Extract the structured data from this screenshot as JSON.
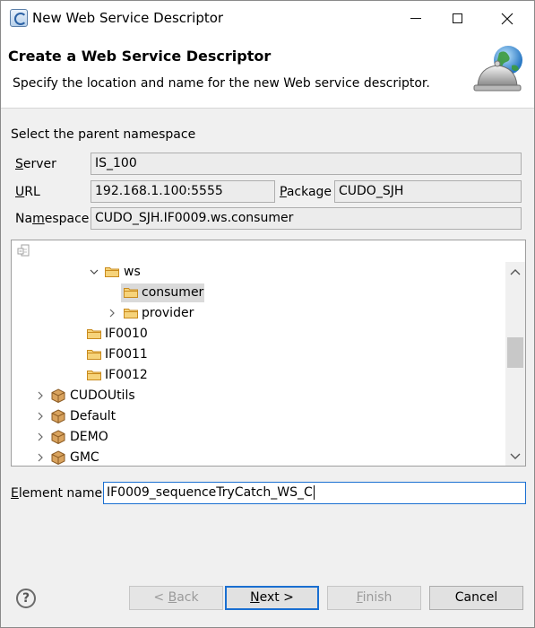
{
  "window": {
    "title": "New Web Service Descriptor"
  },
  "banner": {
    "title": "Create a Web Service Descriptor",
    "message": "Specify the location and name for the new Web service descriptor."
  },
  "form": {
    "section_label": "Select the parent namespace",
    "server": {
      "label_key": "S",
      "label_rest": "erver",
      "value": "IS_100"
    },
    "url": {
      "label_key": "U",
      "label_rest": "RL",
      "value": "192.168.1.100:5555"
    },
    "package": {
      "label_key": "P",
      "label_rest": "ackage",
      "value": "CUDO_SJH"
    },
    "namespace": {
      "label_pre": "Na",
      "label_key": "m",
      "label_rest": "espace",
      "value": "CUDO_SJH.IF0009.ws.consumer"
    }
  },
  "tree": {
    "nodes": [
      {
        "label": "ws",
        "type": "folder",
        "expanded": true
      },
      {
        "label": "consumer",
        "type": "folder",
        "selected": true
      },
      {
        "label": "provider",
        "type": "folder",
        "expanded": false
      },
      {
        "label": "IF0010",
        "type": "folder"
      },
      {
        "label": "IF0011",
        "type": "folder"
      },
      {
        "label": "IF0012",
        "type": "folder"
      },
      {
        "label": "CUDOUtils",
        "type": "package"
      },
      {
        "label": "Default",
        "type": "package"
      },
      {
        "label": "DEMO",
        "type": "package"
      },
      {
        "label": "GMC",
        "type": "package"
      }
    ]
  },
  "element": {
    "label_key": "E",
    "label_rest": "lement name",
    "value": "IF0009_sequenceTryCatch_WS_C"
  },
  "buttons": {
    "back": {
      "pre": "< ",
      "key": "B",
      "rest": "ack"
    },
    "next": {
      "key": "N",
      "rest": "ext >"
    },
    "finish": {
      "key": "F",
      "rest": "inish"
    },
    "cancel": "Cancel"
  },
  "colors": {
    "accent": "#1a6fd1",
    "selection": "#dadada",
    "folder": "#e8a93a",
    "package": "#b07a3a"
  }
}
